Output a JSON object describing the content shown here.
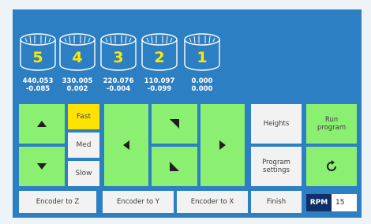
{
  "axes": [
    {
      "number": "5",
      "value1": "440.053",
      "value2": "-0.085"
    },
    {
      "number": "4",
      "value1": "330.005",
      "value2": "0.002"
    },
    {
      "number": "3",
      "value1": "220.076",
      "value2": "-0.004"
    },
    {
      "number": "2",
      "value1": "110.097",
      "value2": "-0.099"
    },
    {
      "number": "1",
      "value1": "0.000",
      "value2": "0.000"
    }
  ],
  "speed": {
    "fast": "Fast",
    "med": "Med",
    "slow": "Slow",
    "selected": "Fast"
  },
  "buttons": {
    "heights": "Heights",
    "run_program": "Run\nprogram",
    "program_settings": "Program\nsettings",
    "encoder_z": "Encoder to Z",
    "encoder_y": "Encoder to Y",
    "encoder_x": "Encoder to X",
    "finish": "Finish"
  },
  "rpm": {
    "label": "RPM",
    "value": "15"
  },
  "colors": {
    "panel": "#2d7fc3",
    "green": "#8bf072",
    "selected": "#ffe300",
    "button": "#f2f2f2",
    "rpm_label": "#0f2f6b"
  },
  "icons": {
    "up": "arrow-up-icon",
    "down": "arrow-down-icon",
    "left": "arrow-left-icon",
    "right": "arrow-right-icon",
    "diag_down": "arrow-diag-down-icon",
    "diag_up": "arrow-diag-up-icon",
    "reset": "reset-icon"
  }
}
